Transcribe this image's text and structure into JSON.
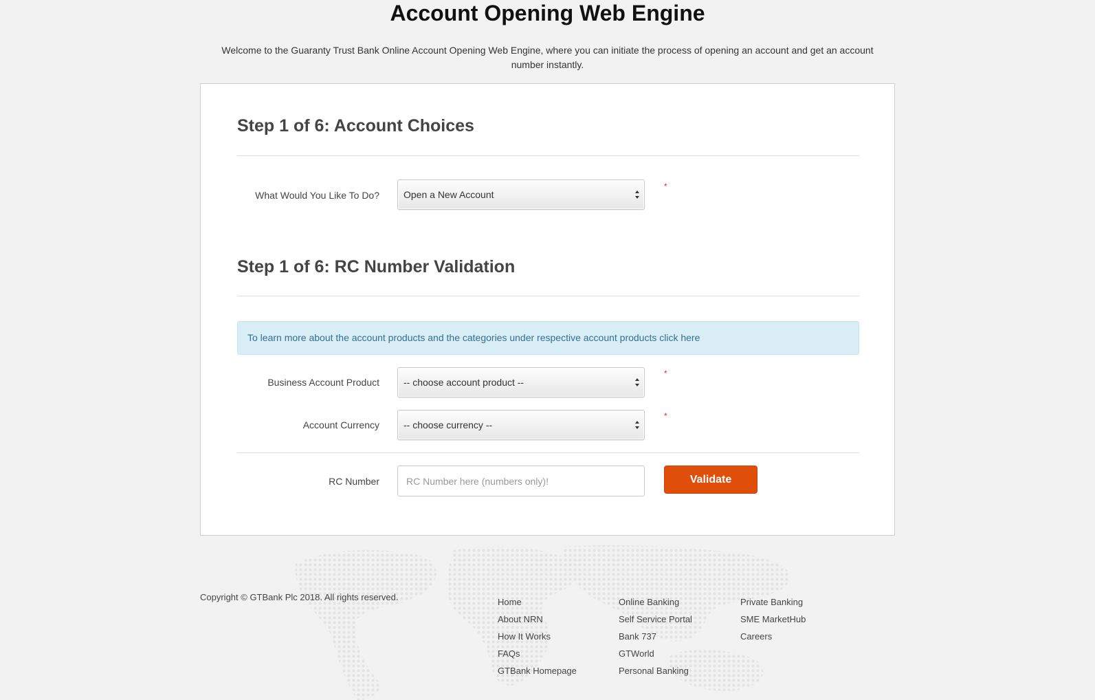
{
  "header": {
    "title": "Account Opening Web Engine",
    "intro": "Welcome to the Guaranty Trust Bank Online Account Opening Web Engine, where you can initiate the process of opening an account and get an account number instantly."
  },
  "step_choices": {
    "title": "Step 1 of 6: Account Choices",
    "action_label": "What Would You Like To Do?",
    "action_value": "Open a New Account",
    "required_mark": "*"
  },
  "step_rc": {
    "title": "Step 1 of 6: RC Number Validation",
    "info_text": "To learn more about the account products and the categories under respective account products click here",
    "product_label": "Business Account Product",
    "product_value": "-- choose account product --",
    "currency_label": "Account Currency",
    "currency_value": "-- choose currency --",
    "rc_label": "RC Number",
    "rc_placeholder": "RC Number here (numbers only)!",
    "validate_label": "Validate",
    "required_mark": "*"
  },
  "footer": {
    "copyright": "Copyright © GTBank Plc 2018. All rights reserved.",
    "col1": [
      "Home",
      "About NRN",
      "How It Works",
      "FAQs",
      "GTBank Homepage"
    ],
    "col2": [
      "Online Banking",
      "Self Service Portal",
      "Bank 737",
      "GTWorld",
      "Personal Banking"
    ],
    "col3": [
      "Private Banking",
      "SME MarketHub",
      "Careers"
    ]
  },
  "colors": {
    "accent": "#e04e0c",
    "info_bg": "#d9edf7",
    "required": "#d9322b"
  }
}
